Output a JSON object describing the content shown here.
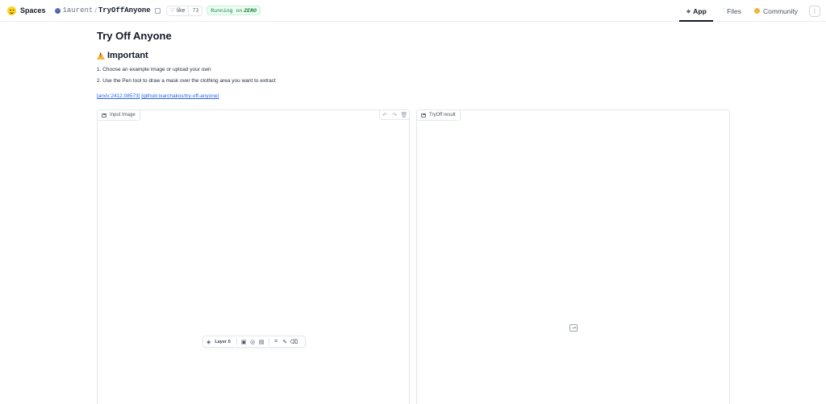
{
  "header": {
    "brand": "Spaces",
    "owner": "1aurent",
    "separator": "/",
    "repo": "TryOffAnyone",
    "like_label": "like",
    "like_count": "73",
    "status_prefix": "Running on",
    "status_hardware": "ZERO",
    "tabs": [
      {
        "label": "App",
        "icon": "app-icon",
        "active": true
      },
      {
        "label": "Files",
        "icon": "files-icon",
        "active": false
      },
      {
        "label": "Community",
        "icon": "community-icon",
        "active": false
      }
    ],
    "menu_glyph": "⋮"
  },
  "main": {
    "title": "Try Off Anyone",
    "warning_title": "Important",
    "steps": [
      "1. Choose an example image or upload your own",
      "2. Use the Pen tool to draw a mask over the clothing area you want to extract"
    ],
    "links": [
      {
        "text": "[arxiv:2412.08573]"
      },
      {
        "text": "[github:ixarchakos/try-off-anyone]"
      }
    ],
    "input_panel": {
      "label": "Input Image",
      "layer_label": "Layer 0"
    },
    "output_panel": {
      "label": "TryOff result"
    }
  },
  "colors": {
    "link": "#2563eb",
    "status_green": "#16803c",
    "status_bg": "#ecfdf3",
    "logo_yellow": "#ffd21e"
  }
}
